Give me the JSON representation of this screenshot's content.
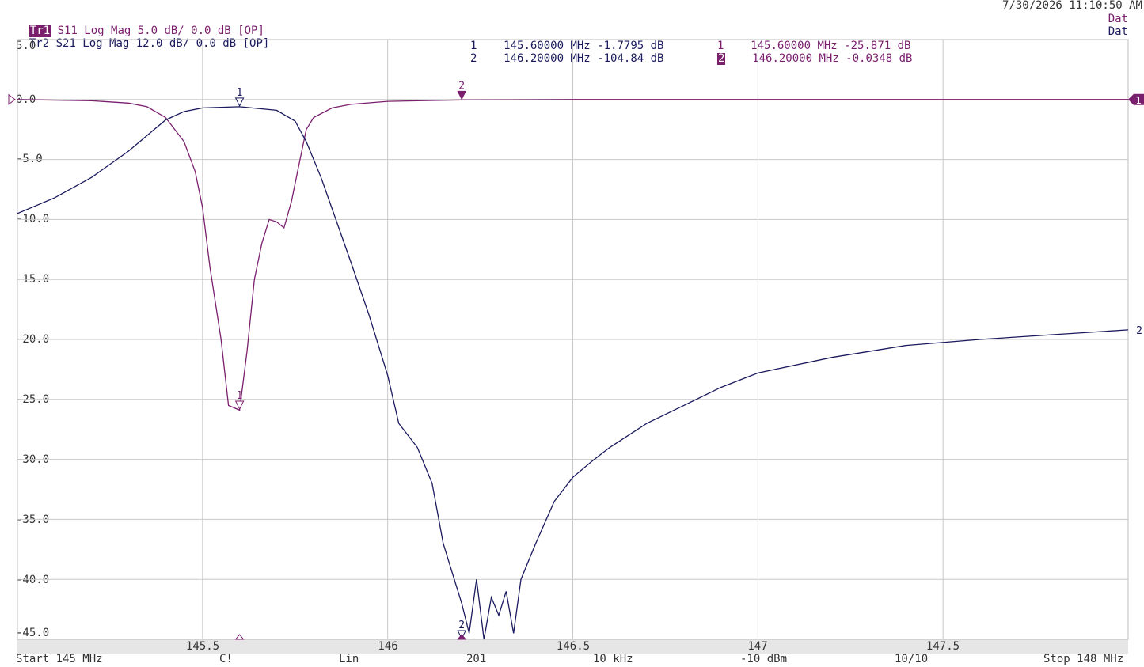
{
  "header": {
    "timestamp": "7/30/2026 11:10:50 AM",
    "traces": [
      {
        "tag": "Tr1",
        "desc": "S11 Log Mag 5.0 dB/ 0.0 dB [OP]",
        "right": "Dat",
        "color": "#7a1f6e"
      },
      {
        "tag": "Tr2",
        "desc": "S21 Log Mag 12.0 dB/ 0.0 dB [OP]",
        "right": "Dat",
        "color": "#1a1a5e"
      }
    ]
  },
  "marker_table": {
    "trace2": [
      {
        "id": "1",
        "freq": "145.60000 MHz",
        "value": "-1.7795 dB"
      },
      {
        "id": "2",
        "freq": "146.20000 MHz",
        "value": "-104.84 dB"
      }
    ],
    "trace1": [
      {
        "id": "1",
        "freq": "145.60000 MHz",
        "value": "-25.871 dB"
      },
      {
        "id": "2",
        "freq": "146.20000 MHz",
        "value": "-0.0348 dB"
      }
    ]
  },
  "footer": {
    "start": "Start 145 MHz",
    "cal": "C!",
    "sweep": "Lin",
    "points": "201",
    "ifbw": "10 kHz",
    "power": "-10 dBm",
    "avg": "10/10",
    "stop": "Stop 148 MHz"
  },
  "chart_data": {
    "type": "line",
    "xlabel": "",
    "ylabel": "",
    "xlim": [
      145,
      148
    ],
    "ylim": [
      -45,
      5
    ],
    "x_ticks": [
      145.5,
      146,
      146.5,
      147,
      147.5
    ],
    "x_tick_labels": [
      "145.5",
      "146",
      "146.5",
      "147",
      "147.5"
    ],
    "y_ticks": [
      5,
      0,
      -5,
      -10,
      -15,
      -20,
      -25,
      -30,
      -35,
      -40,
      -45
    ],
    "y_tick_labels": [
      "5.0",
      "0.0",
      "-5.0",
      "-10.0",
      "-15.0",
      "-20.0",
      "-25.0",
      "-30.0",
      "-35.0",
      "-40.0",
      "-45.0"
    ],
    "grid": true,
    "series": [
      {
        "name": "Tr1",
        "color": "#7a1f6e",
        "points": [
          [
            145,
            0
          ],
          [
            145.2,
            -0.1
          ],
          [
            145.3,
            -0.3
          ],
          [
            145.35,
            -0.6
          ],
          [
            145.4,
            -1.5
          ],
          [
            145.45,
            -3.5
          ],
          [
            145.48,
            -6
          ],
          [
            145.5,
            -9
          ],
          [
            145.52,
            -14
          ],
          [
            145.55,
            -20
          ],
          [
            145.57,
            -25.5
          ],
          [
            145.6,
            -25.9
          ],
          [
            145.62,
            -21
          ],
          [
            145.64,
            -15
          ],
          [
            145.66,
            -12
          ],
          [
            145.68,
            -10
          ],
          [
            145.7,
            -10.2
          ],
          [
            145.72,
            -10.7
          ],
          [
            145.74,
            -8.5
          ],
          [
            145.76,
            -5.5
          ],
          [
            145.78,
            -2.5
          ],
          [
            145.8,
            -1.5
          ],
          [
            145.85,
            -0.7
          ],
          [
            145.9,
            -0.4
          ],
          [
            146,
            -0.15
          ],
          [
            146.2,
            -0.03
          ],
          [
            146.5,
            0
          ],
          [
            147,
            0
          ],
          [
            147.5,
            0
          ],
          [
            148,
            0
          ]
        ]
      },
      {
        "name": "Tr2",
        "color": "#1a1a5e",
        "points": [
          [
            145,
            -9.5
          ],
          [
            145.1,
            -8.2
          ],
          [
            145.2,
            -6.5
          ],
          [
            145.3,
            -4.3
          ],
          [
            145.35,
            -3
          ],
          [
            145.4,
            -1.7
          ],
          [
            145.45,
            -1
          ],
          [
            145.5,
            -0.7
          ],
          [
            145.6,
            -0.6
          ],
          [
            145.7,
            -0.9
          ],
          [
            145.75,
            -1.8
          ],
          [
            145.78,
            -3.5
          ],
          [
            145.82,
            -6.5
          ],
          [
            145.86,
            -10
          ],
          [
            145.9,
            -13.5
          ],
          [
            145.95,
            -18
          ],
          [
            146,
            -23
          ],
          [
            146.03,
            -27
          ],
          [
            146.08,
            -29
          ],
          [
            146.12,
            -32
          ],
          [
            146.15,
            -37
          ],
          [
            146.18,
            -40
          ],
          [
            146.2,
            -42
          ],
          [
            146.22,
            -44.5
          ],
          [
            146.24,
            -40
          ],
          [
            146.26,
            -45
          ],
          [
            146.28,
            -41.5
          ],
          [
            146.3,
            -43
          ],
          [
            146.32,
            -41
          ],
          [
            146.34,
            -44.5
          ],
          [
            146.36,
            -40
          ],
          [
            146.4,
            -37
          ],
          [
            146.45,
            -33.5
          ],
          [
            146.5,
            -31.5
          ],
          [
            146.55,
            -30.2
          ],
          [
            146.6,
            -29
          ],
          [
            146.7,
            -27
          ],
          [
            146.8,
            -25.5
          ],
          [
            146.9,
            -24
          ],
          [
            147,
            -22.8
          ],
          [
            147.2,
            -21.5
          ],
          [
            147.4,
            -20.5
          ],
          [
            147.6,
            -20
          ],
          [
            147.8,
            -19.6
          ],
          [
            148,
            -19.2
          ]
        ]
      }
    ],
    "markers": [
      {
        "trace": "Tr1",
        "id": "1",
        "x": 145.6,
        "y": -25.871,
        "style": "open"
      },
      {
        "trace": "Tr1",
        "id": "2",
        "x": 146.2,
        "y": -0.0348,
        "style": "filled"
      },
      {
        "trace": "Tr2",
        "id": "1",
        "x": 145.6,
        "y": -0.6,
        "style": "open"
      },
      {
        "trace": "Tr2",
        "id": "2",
        "x": 146.2,
        "y": -45,
        "style": "open"
      }
    ],
    "ref_markers": {
      "left_ref": "0.0",
      "right_tr1": "1",
      "right_tr2": "2"
    }
  }
}
